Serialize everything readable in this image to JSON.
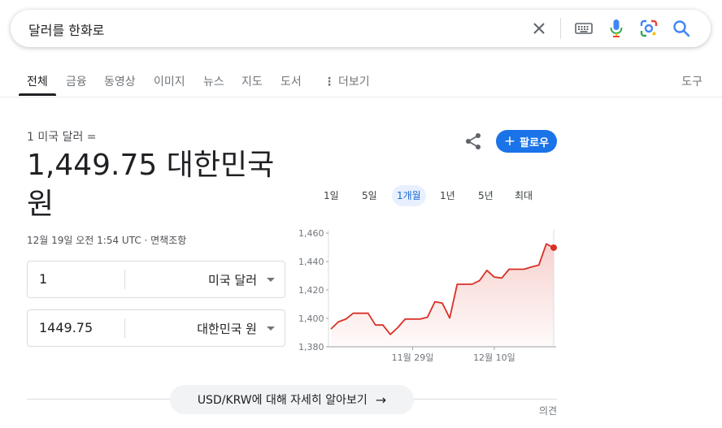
{
  "search": {
    "query": "달러를 한화로"
  },
  "tabs": [
    {
      "label": "전체",
      "active": true
    },
    {
      "label": "금융"
    },
    {
      "label": "동영상"
    },
    {
      "label": "이미지"
    },
    {
      "label": "뉴스"
    },
    {
      "label": "지도"
    },
    {
      "label": "도서"
    },
    {
      "label": "더보기"
    }
  ],
  "tools_label": "도구",
  "converter": {
    "from_line": "1 미국 달러 =",
    "result_value": "1,449.75 대한민국",
    "result_unit": "원",
    "timestamp": "12월 19일 오전 1:54 UTC · ",
    "disclaimer": "면책조항",
    "from_amount": "1",
    "from_currency": "미국 달러",
    "to_amount": "1449.75",
    "to_currency": "대한민국 원"
  },
  "follow_label": "팔로우",
  "ranges": [
    "1일",
    "5일",
    "1개월",
    "1년",
    "5년",
    "최대"
  ],
  "active_range": "1개월",
  "accent_color": "#1a73e8",
  "chart_data": {
    "type": "area",
    "y_ticks": [
      "1,460",
      "1,440",
      "1,420",
      "1,400",
      "1,380"
    ],
    "ylim": [
      1380,
      1460
    ],
    "x_ticks": [
      "11월 29일",
      "12월 10일"
    ],
    "values": [
      1392.5,
      1397.5,
      1399.5,
      1403.6,
      1403.6,
      1403.6,
      1395.3,
      1395.3,
      1388.7,
      1393.5,
      1399.5,
      1399.5,
      1399.5,
      1400.8,
      1411.7,
      1410.7,
      1400.2,
      1424.0,
      1424.0,
      1424.0,
      1426.5,
      1433.8,
      1429.1,
      1428.4,
      1434.6,
      1434.6,
      1434.6,
      1436.1,
      1437.5,
      1452.4,
      1449.75
    ],
    "line_color": "#d93025",
    "grid": false
  },
  "learn_more_label": "USD/KRW에 대해 자세히 알아보기",
  "feedback_label": "의견"
}
